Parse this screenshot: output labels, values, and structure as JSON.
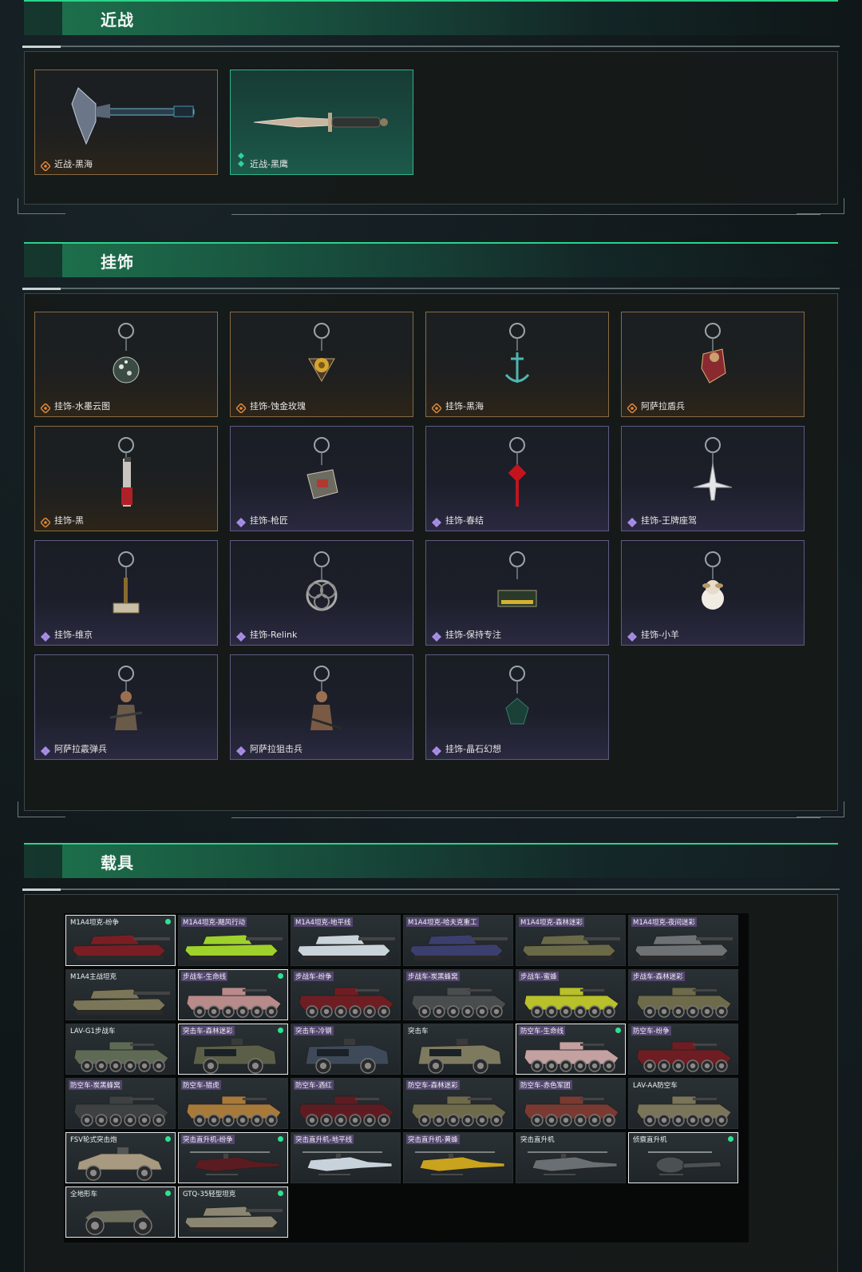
{
  "sections": {
    "melee": {
      "title": "近战",
      "items": [
        {
          "label": "近战-黑海",
          "rarity": "gold",
          "icon": "axe-icon"
        },
        {
          "label": "近战-黑鹰",
          "rarity": "green",
          "icon": "knife-icon"
        }
      ]
    },
    "charms": {
      "title": "挂饰",
      "items": [
        {
          "label": "挂饰-水墨云图",
          "rarity": "gold",
          "icon": "ornament-ball-icon"
        },
        {
          "label": "挂饰-蚀金玫瑰",
          "rarity": "gold",
          "icon": "rose-icon"
        },
        {
          "label": "挂饰-黑海",
          "rarity": "gold",
          "icon": "anchor-icon"
        },
        {
          "label": "阿萨拉盾兵",
          "rarity": "gold",
          "icon": "shield-soldier-icon"
        },
        {
          "label": "挂饰-黑",
          "rarity": "gold",
          "icon": "blade-icon"
        },
        {
          "label": "挂饰-枪匠",
          "rarity": "purple",
          "icon": "toolbox-icon"
        },
        {
          "label": "挂饰-春结",
          "rarity": "purple",
          "icon": "chinese-knot-icon"
        },
        {
          "label": "挂饰-王牌座驾",
          "rarity": "purple",
          "icon": "jet-icon"
        },
        {
          "label": "挂饰-维京",
          "rarity": "purple",
          "icon": "hammer-icon"
        },
        {
          "label": "挂饰-Relink",
          "rarity": "purple",
          "icon": "relink-logo-icon"
        },
        {
          "label": "挂饰-保持专注",
          "rarity": "purple",
          "icon": "tag-icon"
        },
        {
          "label": "挂饰-小羊",
          "rarity": "purple",
          "icon": "lamb-icon"
        },
        {
          "label": "阿萨拉霰弹兵",
          "rarity": "purple",
          "icon": "soldier-icon"
        },
        {
          "label": "阿萨拉狙击兵",
          "rarity": "purple",
          "icon": "sniper-icon"
        },
        {
          "label": "挂饰-晶石幻想",
          "rarity": "purple",
          "icon": "crystal-icon"
        }
      ]
    },
    "vehicles": {
      "title": "载具",
      "items": [
        {
          "label": "M1A4坦克-纷争",
          "tag": false,
          "sel": true,
          "dot": true,
          "kind": "tank",
          "color": "#7a1e24"
        },
        {
          "label": "M1A4坦克-飓风行动",
          "tag": true,
          "sel": false,
          "dot": false,
          "kind": "tank",
          "color": "#9ed12b"
        },
        {
          "label": "M1A4坦克-地平线",
          "tag": true,
          "sel": false,
          "dot": false,
          "kind": "tank",
          "color": "#c9d3da"
        },
        {
          "label": "M1A4坦克-哈夫克重工",
          "tag": true,
          "sel": false,
          "dot": false,
          "kind": "tank",
          "color": "#3b3f6e"
        },
        {
          "label": "M1A4坦克-森林迷彩",
          "tag": true,
          "sel": false,
          "dot": false,
          "kind": "tank",
          "color": "#6b6a48"
        },
        {
          "label": "M1A4坦克-夜间迷彩",
          "tag": true,
          "sel": false,
          "dot": false,
          "kind": "tank",
          "color": "#6e7275"
        },
        {
          "label": "M1A4主战坦克",
          "tag": false,
          "sel": false,
          "dot": false,
          "kind": "tank",
          "color": "#7a7657"
        },
        {
          "label": "步战车-生命线",
          "tag": true,
          "sel": true,
          "dot": true,
          "kind": "ifv",
          "color": "#b88a8a"
        },
        {
          "label": "步战车-纷争",
          "tag": true,
          "sel": false,
          "dot": false,
          "kind": "ifv",
          "color": "#6e1e22"
        },
        {
          "label": "步战车-炭黑蜂窝",
          "tag": true,
          "sel": false,
          "dot": false,
          "kind": "ifv",
          "color": "#4a4d4e"
        },
        {
          "label": "步战车-蜜蜂",
          "tag": true,
          "sel": false,
          "dot": false,
          "kind": "ifv",
          "color": "#b8c02a"
        },
        {
          "label": "步战车-森林迷彩",
          "tag": true,
          "sel": false,
          "dot": false,
          "kind": "ifv",
          "color": "#6d6b4b"
        },
        {
          "label": "LAV-G1步战车",
          "tag": false,
          "sel": false,
          "dot": false,
          "kind": "ifv",
          "color": "#5f6a55"
        },
        {
          "label": "突击车-森林迷彩",
          "tag": true,
          "sel": true,
          "dot": true,
          "kind": "mrap",
          "color": "#5c5f47"
        },
        {
          "label": "突击车-冷钢",
          "tag": true,
          "sel": false,
          "dot": false,
          "kind": "mrap",
          "color": "#3e4a5a"
        },
        {
          "label": "突击车",
          "tag": false,
          "sel": false,
          "dot": false,
          "kind": "mrap",
          "color": "#7d7a60"
        },
        {
          "label": "防空车-生命线",
          "tag": true,
          "sel": true,
          "dot": true,
          "kind": "ifv",
          "color": "#c4a0a0"
        },
        {
          "label": "防空车-纷争",
          "tag": true,
          "sel": false,
          "dot": false,
          "kind": "ifv",
          "color": "#6e1e22"
        },
        {
          "label": "防空车-炭黑蜂窝",
          "tag": true,
          "sel": false,
          "dot": false,
          "kind": "ifv",
          "color": "#3e4142"
        },
        {
          "label": "防空车-猎虎",
          "tag": true,
          "sel": false,
          "dot": false,
          "kind": "ifv",
          "color": "#a87a3a"
        },
        {
          "label": "防空车-酒红",
          "tag": true,
          "sel": false,
          "dot": false,
          "kind": "ifv",
          "color": "#5e1c22"
        },
        {
          "label": "防空车-森林迷彩",
          "tag": true,
          "sel": false,
          "dot": false,
          "kind": "ifv",
          "color": "#6e6a4a"
        },
        {
          "label": "防空车-赤色军团",
          "tag": true,
          "sel": false,
          "dot": false,
          "kind": "ifv",
          "color": "#7a3a32"
        },
        {
          "label": "LAV-AA防空车",
          "tag": false,
          "sel": false,
          "dot": false,
          "kind": "ifv",
          "color": "#7a7458"
        },
        {
          "label": "FSV轮式突击炮",
          "tag": false,
          "sel": true,
          "dot": true,
          "kind": "buggy",
          "color": "#a89a80"
        },
        {
          "label": "突击直升机-纷争",
          "tag": true,
          "sel": true,
          "dot": true,
          "kind": "heli",
          "color": "#5a1c20"
        },
        {
          "label": "突击直升机-地平线",
          "tag": true,
          "sel": false,
          "dot": false,
          "kind": "heli",
          "color": "#c8d2da"
        },
        {
          "label": "突击直升机-黄蜂",
          "tag": true,
          "sel": false,
          "dot": false,
          "kind": "heli",
          "color": "#c9a21e"
        },
        {
          "label": "突击直升机",
          "tag": false,
          "sel": false,
          "dot": false,
          "kind": "heli",
          "color": "#6a6f73"
        },
        {
          "label": "侦察直升机",
          "tag": false,
          "sel": true,
          "dot": true,
          "kind": "scout",
          "color": "#4a5054"
        },
        {
          "label": "全地形车",
          "tag": false,
          "sel": true,
          "dot": true,
          "kind": "atv",
          "color": "#6d6e5c"
        },
        {
          "label": "GTQ-35轻型坦克",
          "tag": false,
          "sel": true,
          "dot": true,
          "kind": "tank",
          "color": "#8a8672"
        }
      ]
    }
  },
  "colors": {
    "accent_green": "#2bd38a",
    "rarity_gold": "#e08a3c",
    "rarity_purple": "#a98ee6",
    "rarity_green": "#2fd39a",
    "owned_dot": "#2fe28f"
  }
}
